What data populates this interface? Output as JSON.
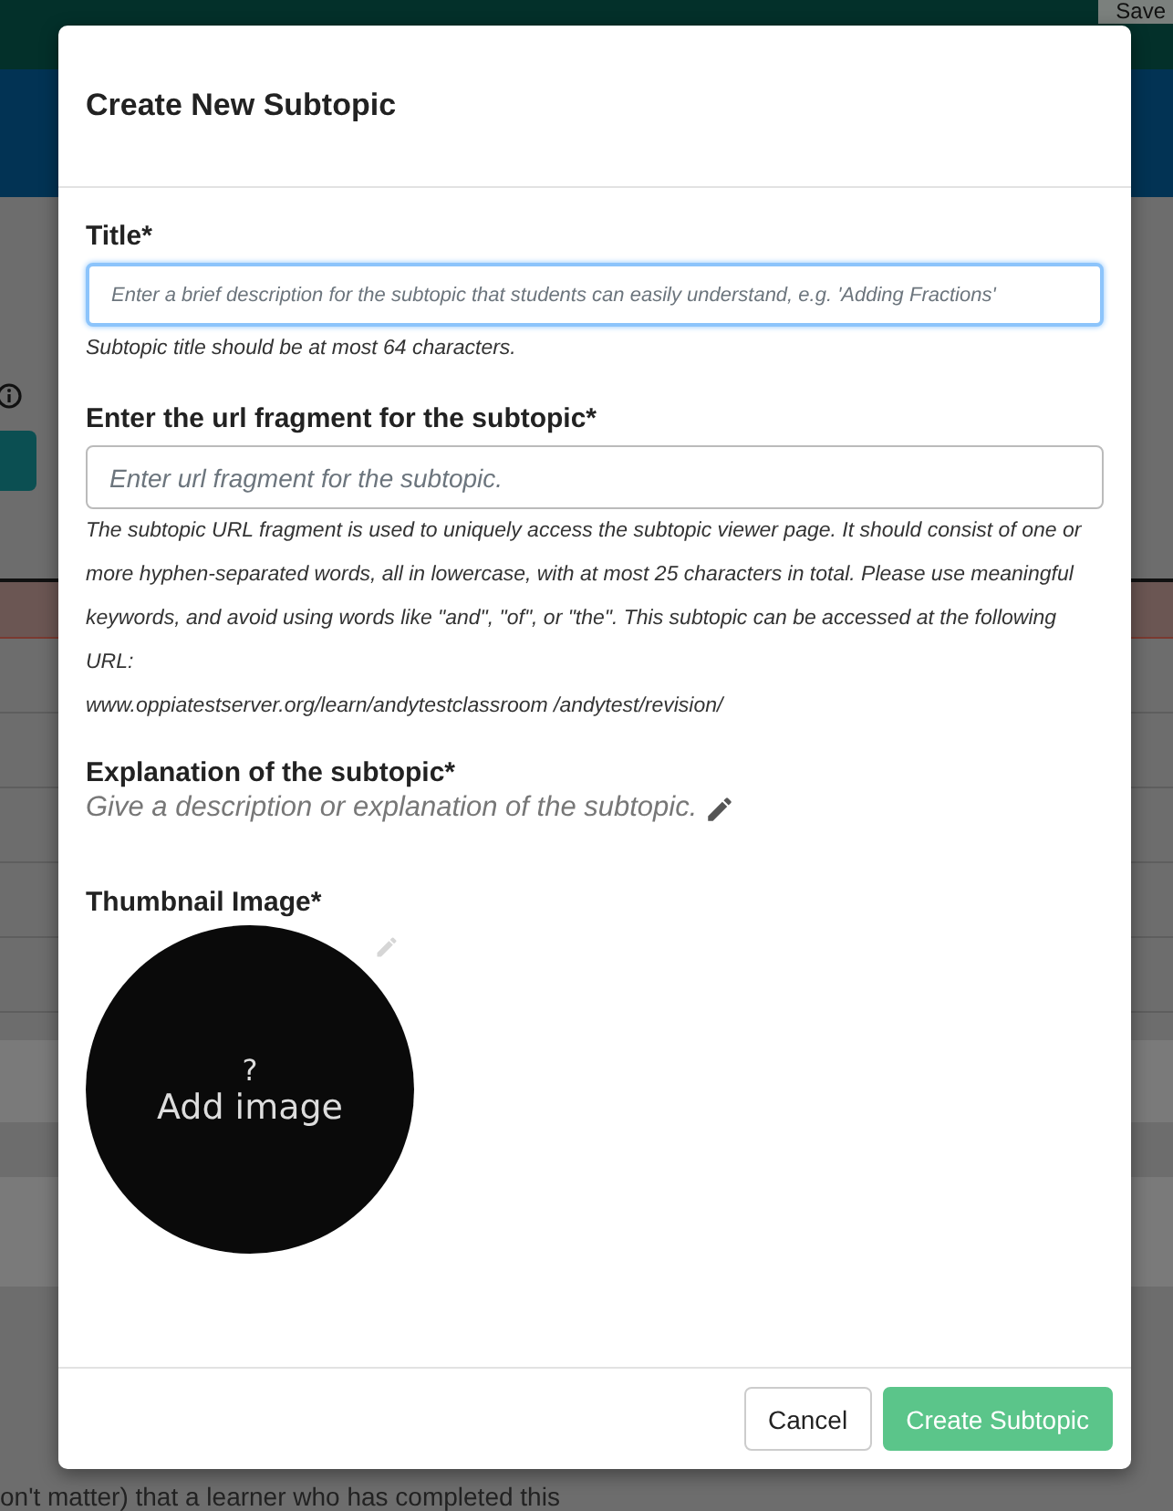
{
  "header": {
    "save_button": "Save"
  },
  "background_text": "on't matter) that a learner who has completed this",
  "dialog": {
    "title": "Create New Subtopic",
    "title_field": {
      "label": "Title*",
      "placeholder": "Enter a brief description for the subtopic that students can easily understand, e.g. 'Adding Fractions'",
      "hint": "Subtopic title should be at most 64 characters."
    },
    "url_field": {
      "label": "Enter the url fragment for the subtopic*",
      "placeholder": "Enter url fragment for the subtopic.",
      "help": "The subtopic URL fragment is used to uniquely access the subtopic viewer page. It should consist of one or more hyphen-separated words, all in lowercase, with at most 25 characters in total. Please use meaningful keywords, and avoid using words like \"and\", \"of\", or \"the\". This subtopic can be accessed at the following URL:",
      "url": "www.oppiatestserver.org/learn/andytestclassroom /andytest/revision/"
    },
    "explanation": {
      "label": "Explanation of the subtopic*",
      "placeholder": "Give a description or explanation of the subtopic."
    },
    "thumbnail": {
      "label": "Thumbnail Image*",
      "mark": "?",
      "action": "Add image"
    },
    "buttons": [
      {
        "label": "Cancel",
        "kind": "secondary"
      },
      {
        "label": "Create Subtopic",
        "kind": "primary"
      }
    ]
  }
}
